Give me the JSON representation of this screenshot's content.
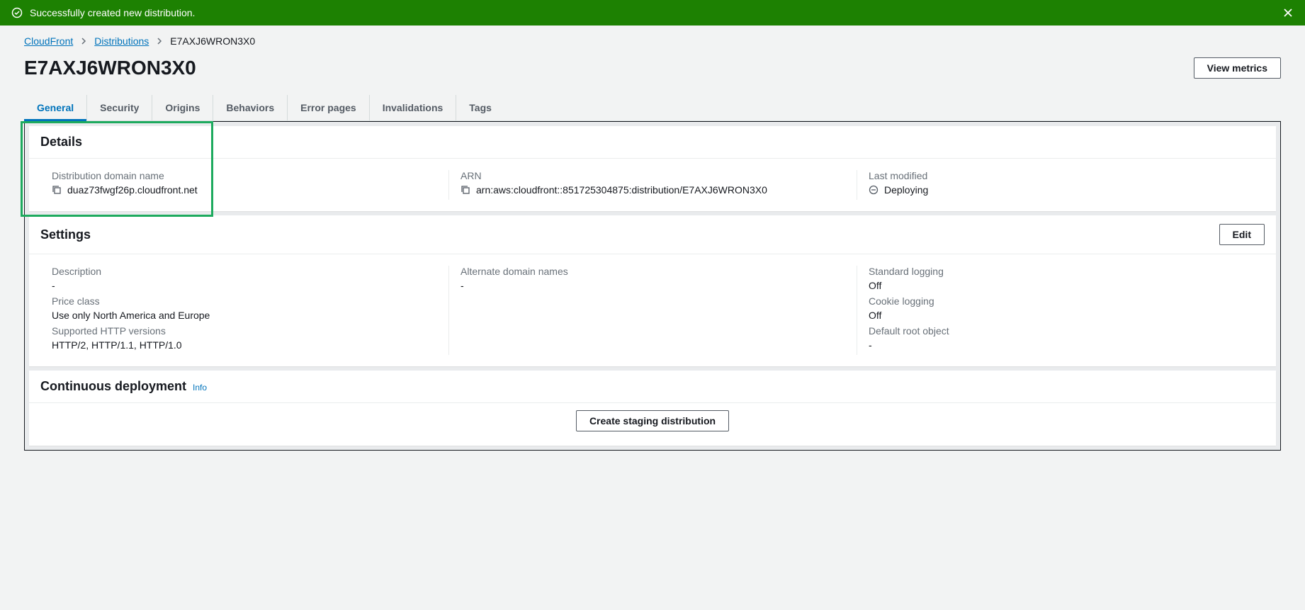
{
  "banner": {
    "message": "Successfully created new distribution."
  },
  "breadcrumb": {
    "service": "CloudFront",
    "section": "Distributions",
    "current": "E7AXJ6WRON3X0"
  },
  "header": {
    "title": "E7AXJ6WRON3X0",
    "view_metrics": "View metrics"
  },
  "tabs": [
    {
      "label": "General",
      "active": true
    },
    {
      "label": "Security"
    },
    {
      "label": "Origins"
    },
    {
      "label": "Behaviors"
    },
    {
      "label": "Error pages"
    },
    {
      "label": "Invalidations"
    },
    {
      "label": "Tags"
    }
  ],
  "details": {
    "title": "Details",
    "domain_label": "Distribution domain name",
    "domain_value": "duaz73fwgf26p.cloudfront.net",
    "arn_label": "ARN",
    "arn_value": "arn:aws:cloudfront::851725304875:distribution/E7AXJ6WRON3X0",
    "modified_label": "Last modified",
    "modified_value": "Deploying"
  },
  "settings": {
    "title": "Settings",
    "edit": "Edit",
    "col1": {
      "description_label": "Description",
      "description_value": "-",
      "price_label": "Price class",
      "price_value": "Use only North America and Europe",
      "http_label": "Supported HTTP versions",
      "http_value": "HTTP/2, HTTP/1.1, HTTP/1.0"
    },
    "col2": {
      "alt_label": "Alternate domain names",
      "alt_value": "-"
    },
    "col3": {
      "std_log_label": "Standard logging",
      "std_log_value": "Off",
      "cookie_log_label": "Cookie logging",
      "cookie_log_value": "Off",
      "root_label": "Default root object",
      "root_value": "-"
    }
  },
  "continuous": {
    "title": "Continuous deployment",
    "info": "Info",
    "create_button": "Create staging distribution"
  }
}
